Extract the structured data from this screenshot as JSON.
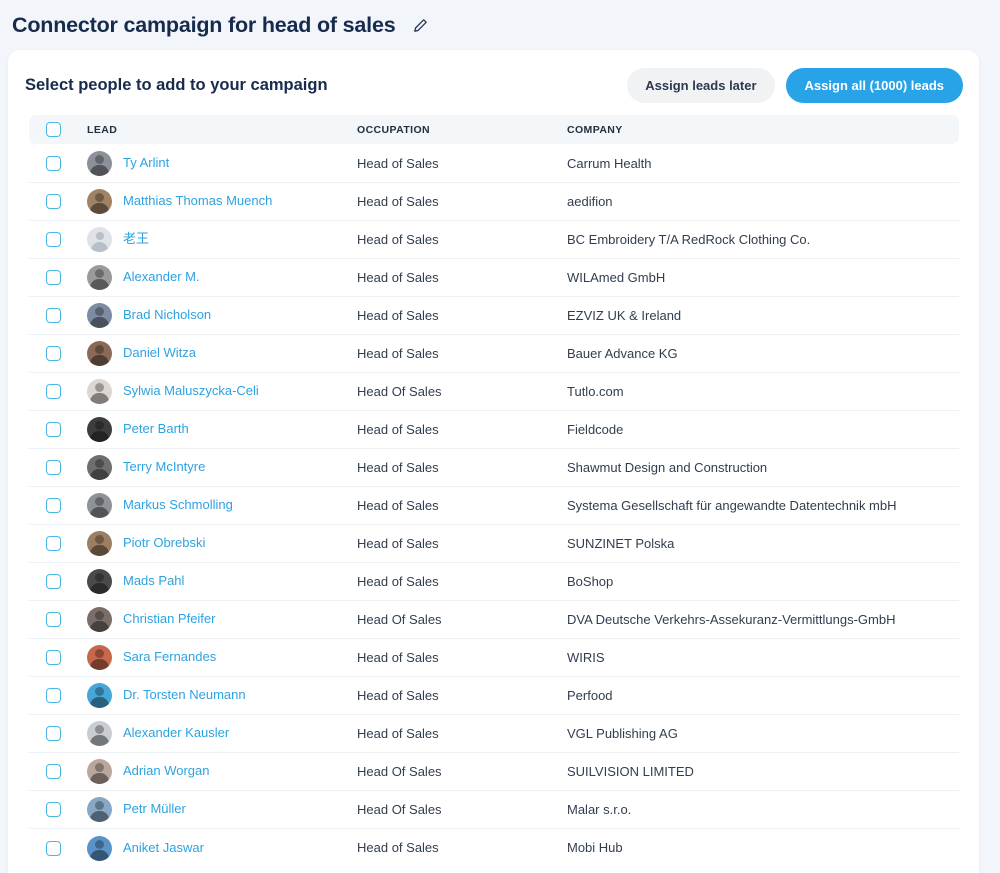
{
  "header": {
    "title": "Connector campaign for head of sales",
    "edit_icon": "pencil-edit-icon"
  },
  "card": {
    "title": "Select people to add to your campaign",
    "buttons": {
      "secondary_label": "Assign leads later",
      "primary_label": "Assign all (1000) leads"
    }
  },
  "colors": {
    "accent": "#28a3e8",
    "link": "#2ea2e0",
    "checkbox_border": "#49b6e8",
    "page_bg": "#f2f5fa",
    "header_row_bg": "#f4f7fa",
    "text": "#313e4f",
    "secondary_button_bg": "#f1f2f4"
  },
  "table": {
    "columns": [
      "LEAD",
      "OCCUPATION",
      "COMPANY"
    ],
    "select_all_checkbox": "unchecked",
    "rows": [
      {
        "name": "Ty Arlint",
        "occupation": "Head of Sales",
        "company": "Carrum Health",
        "avatar": "photo",
        "avatar_color": "#8c9099",
        "checked": false
      },
      {
        "name": "Matthias Thomas Muench",
        "occupation": "Head of Sales",
        "company": "aedifion",
        "avatar": "photo",
        "avatar_color": "#a08264",
        "checked": false
      },
      {
        "name": "老王",
        "occupation": "Head of Sales",
        "company": "BC Embroidery T/A RedRock Clothing Co.",
        "avatar": "generic",
        "avatar_color": "#dfe3e8",
        "checked": false
      },
      {
        "name": "Alexander M.",
        "occupation": "Head of Sales",
        "company": "WILAmed GmbH",
        "avatar": "photo",
        "avatar_color": "#9a9a9a",
        "checked": false
      },
      {
        "name": "Brad Nicholson",
        "occupation": "Head of Sales",
        "company": "EZVIZ UK & Ireland",
        "avatar": "photo",
        "avatar_color": "#7d8ca0",
        "checked": false
      },
      {
        "name": "Daniel Witza",
        "occupation": "Head of Sales",
        "company": "Bauer Advance KG",
        "avatar": "photo",
        "avatar_color": "#8a6a56",
        "checked": false
      },
      {
        "name": "Sylwia Maluszycka-Celi",
        "occupation": "Head Of Sales",
        "company": "Tutlo.com",
        "avatar": "photo",
        "avatar_color": "#ded6d0",
        "checked": false
      },
      {
        "name": "Peter Barth",
        "occupation": "Head of Sales",
        "company": "Fieldcode",
        "avatar": "photo",
        "avatar_color": "#3d3d3d",
        "checked": false
      },
      {
        "name": "Terry McIntyre",
        "occupation": "Head of Sales",
        "company": "Shawmut Design and Construction",
        "avatar": "photo",
        "avatar_color": "#6e6e6e",
        "checked": false
      },
      {
        "name": "Markus Schmolling",
        "occupation": "Head of Sales",
        "company": "Systema Gesellschaft für angewandte Datentechnik mbH",
        "avatar": "photo",
        "avatar_color": "#8f9296",
        "checked": false
      },
      {
        "name": "Piotr Obrebski",
        "occupation": "Head of Sales",
        "company": "SUNZINET Polska",
        "avatar": "photo",
        "avatar_color": "#9c7f63",
        "checked": false
      },
      {
        "name": "Mads Pahl",
        "occupation": "Head of Sales",
        "company": "BoShop",
        "avatar": "photo",
        "avatar_color": "#4a4a4a",
        "checked": false
      },
      {
        "name": "Christian Pfeifer",
        "occupation": "Head Of Sales",
        "company": "DVA Deutsche Verkehrs-Assekuranz-Vermittlungs-GmbH",
        "avatar": "photo",
        "avatar_color": "#7a6f68",
        "checked": false
      },
      {
        "name": "Sara Fernandes",
        "occupation": "Head of Sales",
        "company": "WIRIS",
        "avatar": "photo",
        "avatar_color": "#c6684c",
        "checked": false
      },
      {
        "name": "Dr. Torsten Neumann",
        "occupation": "Head of Sales",
        "company": "Perfood",
        "avatar": "photo",
        "avatar_color": "#47a6d8",
        "checked": false
      },
      {
        "name": "Alexander Kausler",
        "occupation": "Head of Sales",
        "company": "VGL Publishing AG",
        "avatar": "photo",
        "avatar_color": "#c9cdd2",
        "checked": false
      },
      {
        "name": "Adrian Worgan",
        "occupation": "Head Of Sales",
        "company": "SUILVISION LIMITED",
        "avatar": "photo",
        "avatar_color": "#b9a79b",
        "checked": false
      },
      {
        "name": "Petr Müller",
        "occupation": "Head Of Sales",
        "company": "Malar s.r.o.",
        "avatar": "photo",
        "avatar_color": "#87a7c4",
        "checked": false
      },
      {
        "name": "Aniket Jaswar",
        "occupation": "Head of Sales",
        "company": "Mobi Hub",
        "avatar": "photo",
        "avatar_color": "#5b93c9",
        "checked": false
      }
    ]
  }
}
